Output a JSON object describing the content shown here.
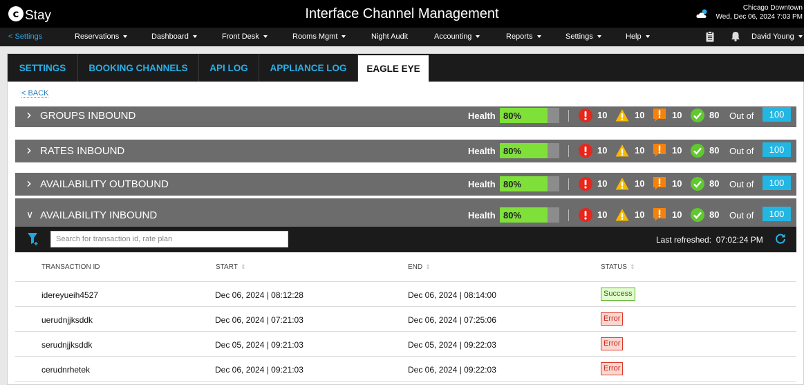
{
  "header": {
    "logo_letter": "c",
    "logo_text": "Stay",
    "title": "Interface Channel Management",
    "location": "Chicago Downtown",
    "datetime": "Wed, Dec 06, 2024 7:03 PM"
  },
  "nav": {
    "back": "< Settings",
    "items": [
      {
        "label": "Reservations",
        "dropdown": true
      },
      {
        "label": "Dashboard",
        "dropdown": true
      },
      {
        "label": "Front Desk",
        "dropdown": true
      },
      {
        "label": "Rooms Mgmt",
        "dropdown": true
      },
      {
        "label": "Night Audit",
        "dropdown": false
      },
      {
        "label": "Accounting",
        "dropdown": true
      },
      {
        "label": "Reports",
        "dropdown": true
      },
      {
        "label": "Settings",
        "dropdown": true
      },
      {
        "label": "Help",
        "dropdown": true
      }
    ],
    "user": "David Young"
  },
  "tabs": [
    {
      "label": "SETTINGS",
      "active": false
    },
    {
      "label": "BOOKING CHANNELS",
      "active": false
    },
    {
      "label": "API LOG",
      "active": false
    },
    {
      "label": "APPLIANCE LOG",
      "active": false
    },
    {
      "label": "EAGLE EYE",
      "active": true
    }
  ],
  "back_link": "< BACK",
  "sections": [
    {
      "title": "GROUPS INBOUND",
      "expanded": false,
      "health_label": "Health",
      "health": "80%",
      "health_fraction": 0.8,
      "critical": "10",
      "warning": "10",
      "notice": "10",
      "ok": "80",
      "out_of_label": "Out of",
      "total": "100"
    },
    {
      "title": "RATES INBOUND",
      "expanded": false,
      "health_label": "Health",
      "health": "80%",
      "health_fraction": 0.8,
      "critical": "10",
      "warning": "10",
      "notice": "10",
      "ok": "80",
      "out_of_label": "Out of",
      "total": "100"
    },
    {
      "title": "AVAILABILITY OUTBOUND",
      "expanded": false,
      "health_label": "Health",
      "health": "80%",
      "health_fraction": 0.8,
      "critical": "10",
      "warning": "10",
      "notice": "10",
      "ok": "80",
      "out_of_label": "Out of",
      "total": "100"
    },
    {
      "title": "AVAILABILITY INBOUND",
      "expanded": true,
      "health_label": "Health",
      "health": "80%",
      "health_fraction": 0.8,
      "critical": "10",
      "warning": "10",
      "notice": "10",
      "ok": "80",
      "out_of_label": "Out of",
      "total": "100"
    }
  ],
  "toolbar": {
    "search_placeholder": "Search for transaction id, rate plan",
    "search_value": "",
    "refreshed_label": "Last refreshed:",
    "refreshed_time": "07:02:24 PM"
  },
  "table": {
    "columns": [
      "TRANSACTION ID",
      "START",
      "END",
      "STATUS"
    ],
    "rows": [
      {
        "id": "idereyueih4527",
        "start": "Dec 06, 2024 | 08:12:28",
        "end": "Dec 06, 2024 | 08:14:00",
        "status": "Success"
      },
      {
        "id": "uerudnjjksddk",
        "start": "Dec 06, 2024 | 07:21:03",
        "end": "Dec 06, 2024 | 07:25:06",
        "status": "Error"
      },
      {
        "id": "serudnjjksddk",
        "start": "Dec 05, 2024 | 09:21:03",
        "end": "Dec 05, 2024 | 09:22:03",
        "status": "Error"
      },
      {
        "id": "cerudnrhetek",
        "start": "Dec 06, 2024 | 09:21:03",
        "end": "Dec 06, 2024 | 09:22:03",
        "status": "Error"
      }
    ]
  },
  "colors": {
    "accent": "#2ab0e8",
    "health_fill": "#7fe03a",
    "critical": "#e8261b",
    "warning": "#f6b800",
    "notice": "#f5820d",
    "ok": "#5fc92e",
    "total_badge": "#23b6e3"
  },
  "icons": {
    "critical": "exclamation-circle-icon",
    "warning": "warning-triangle-icon",
    "notice": "notice-flag-icon",
    "ok": "check-circle-icon",
    "filter": "filter-icon",
    "refresh": "refresh-icon",
    "clipboard": "clipboard-icon",
    "bell": "bell-icon",
    "weather": "cloud-icon"
  }
}
